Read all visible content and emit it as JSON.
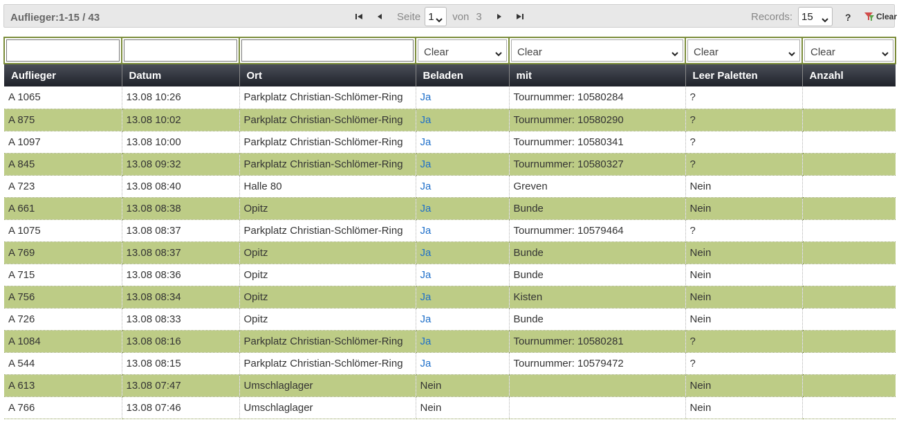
{
  "toolbar": {
    "summary": "Auflieger:1-15 / 43",
    "page_label": "Seite",
    "page_value": "1",
    "of_label": "von",
    "page_total": "3",
    "records_label": "Records:",
    "records_value": "15",
    "help_label": "?",
    "clear_label": "Clear"
  },
  "filters": {
    "clear_label": "Clear"
  },
  "columns": [
    "Auflieger",
    "Datum",
    "Ort",
    "Beladen",
    "mit",
    "Leer Paletten",
    "Anzahl"
  ],
  "rows": [
    {
      "auflieger": "A 1065",
      "datum": "13.08 10:26",
      "ort": "Parkplatz Christian-Schlömer-Ring",
      "beladen": "Ja",
      "beladen_link": true,
      "mit": "Tournummer: 10580284",
      "leer": "?",
      "anzahl": ""
    },
    {
      "auflieger": "A 875",
      "datum": "13.08 10:02",
      "ort": "Parkplatz Christian-Schlömer-Ring",
      "beladen": "Ja",
      "beladen_link": true,
      "mit": "Tournummer: 10580290",
      "leer": "?",
      "anzahl": ""
    },
    {
      "auflieger": "A 1097",
      "datum": "13.08 10:00",
      "ort": "Parkplatz Christian-Schlömer-Ring",
      "beladen": "Ja",
      "beladen_link": true,
      "mit": "Tournummer: 10580341",
      "leer": "?",
      "anzahl": ""
    },
    {
      "auflieger": "A 845",
      "datum": "13.08 09:32",
      "ort": "Parkplatz Christian-Schlömer-Ring",
      "beladen": "Ja",
      "beladen_link": true,
      "mit": "Tournummer: 10580327",
      "leer": "?",
      "anzahl": ""
    },
    {
      "auflieger": "A 723",
      "datum": "13.08 08:40",
      "ort": "Halle 80",
      "beladen": "Ja",
      "beladen_link": true,
      "mit": "Greven",
      "leer": "Nein",
      "anzahl": ""
    },
    {
      "auflieger": "A 661",
      "datum": "13.08 08:38",
      "ort": "Opitz",
      "beladen": "Ja",
      "beladen_link": true,
      "mit": "Bunde",
      "leer": "Nein",
      "anzahl": ""
    },
    {
      "auflieger": "A 1075",
      "datum": "13.08 08:37",
      "ort": "Parkplatz Christian-Schlömer-Ring",
      "beladen": "Ja",
      "beladen_link": true,
      "mit": "Tournummer: 10579464",
      "leer": "?",
      "anzahl": ""
    },
    {
      "auflieger": "A 769",
      "datum": "13.08 08:37",
      "ort": "Opitz",
      "beladen": "Ja",
      "beladen_link": true,
      "mit": "Bunde",
      "leer": "Nein",
      "anzahl": ""
    },
    {
      "auflieger": "A 715",
      "datum": "13.08 08:36",
      "ort": "Opitz",
      "beladen": "Ja",
      "beladen_link": true,
      "mit": "Bunde",
      "leer": "Nein",
      "anzahl": ""
    },
    {
      "auflieger": "A 756",
      "datum": "13.08 08:34",
      "ort": "Opitz",
      "beladen": "Ja",
      "beladen_link": true,
      "mit": "Kisten",
      "leer": "Nein",
      "anzahl": ""
    },
    {
      "auflieger": "A 726",
      "datum": "13.08 08:33",
      "ort": "Opitz",
      "beladen": "Ja",
      "beladen_link": true,
      "mit": "Bunde",
      "leer": "Nein",
      "anzahl": ""
    },
    {
      "auflieger": "A 1084",
      "datum": "13.08 08:16",
      "ort": "Parkplatz Christian-Schlömer-Ring",
      "beladen": "Ja",
      "beladen_link": true,
      "mit": "Tournummer: 10580281",
      "leer": "?",
      "anzahl": ""
    },
    {
      "auflieger": "A 544",
      "datum": "13.08 08:15",
      "ort": "Parkplatz Christian-Schlömer-Ring",
      "beladen": "Ja",
      "beladen_link": true,
      "mit": "Tournummer: 10579472",
      "leer": "?",
      "anzahl": ""
    },
    {
      "auflieger": "A 613",
      "datum": "13.08 07:47",
      "ort": "Umschlaglager",
      "beladen": "Nein",
      "beladen_link": false,
      "mit": "",
      "leer": "Nein",
      "anzahl": ""
    },
    {
      "auflieger": "A 766",
      "datum": "13.08 07:46",
      "ort": "Umschlaglager",
      "beladen": "Nein",
      "beladen_link": false,
      "mit": "",
      "leer": "Nein",
      "anzahl": ""
    }
  ],
  "colors": {
    "header_dark": "#1f222a",
    "row_alt": "#bdcc86",
    "filter_border": "#7b8c3a",
    "link": "#1e6fc9"
  },
  "icons": {
    "first": "first-page-icon",
    "prev": "prev-page-icon",
    "next": "next-page-icon",
    "last": "last-page-icon",
    "dropdown": "chevron-down-icon",
    "clear": "clear-filter-icon"
  }
}
